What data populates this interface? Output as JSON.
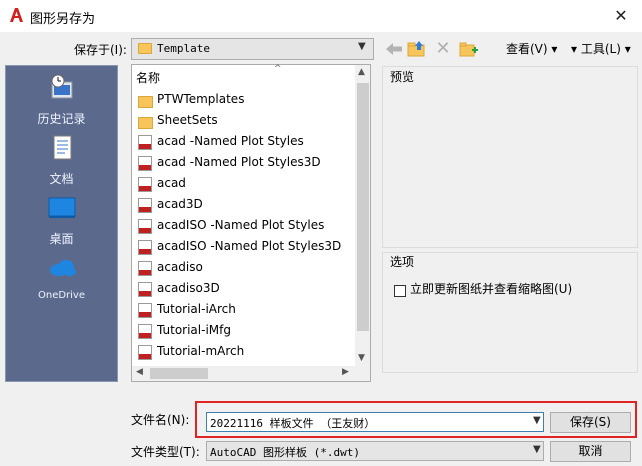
{
  "window": {
    "title": "图形另存为",
    "close_glyph": "✕",
    "icon": "autocad-a-icon"
  },
  "colors": {
    "accent": "#3c7fb1",
    "highlight": "#e02424",
    "places_bg": "#5b6a8c",
    "folder": "#f7c55a",
    "dwg_red": "#c02020"
  },
  "toolbar": {
    "save_in_label": "保存于(I):",
    "save_in_value": "Template",
    "view_menu": "查看(V)  ▾",
    "tools_menu": "▾  工具(L)  ▾",
    "icons": [
      "back-arrow-icon",
      "up-folder-icon",
      "delete-icon",
      "new-folder-icon"
    ]
  },
  "places": [
    {
      "label": "历史记录",
      "icon": "history-icon"
    },
    {
      "label": "文档",
      "icon": "documents-icon"
    },
    {
      "label": "桌面",
      "icon": "desktop-icon"
    },
    {
      "label": "OneDrive",
      "icon": "onedrive-icon"
    }
  ],
  "file_list": {
    "column_header": "名称",
    "items": [
      {
        "name": "PTWTemplates",
        "type": "folder"
      },
      {
        "name": "SheetSets",
        "type": "folder"
      },
      {
        "name": "acad -Named Plot Styles",
        "type": "dwt"
      },
      {
        "name": "acad -Named Plot Styles3D",
        "type": "dwt"
      },
      {
        "name": "acad",
        "type": "dwt"
      },
      {
        "name": "acad3D",
        "type": "dwt"
      },
      {
        "name": "acadISO -Named Plot Styles",
        "type": "dwt"
      },
      {
        "name": "acadISO -Named Plot Styles3D",
        "type": "dwt"
      },
      {
        "name": "acadiso",
        "type": "dwt"
      },
      {
        "name": "acadiso3D",
        "type": "dwt"
      },
      {
        "name": "Tutorial-iArch",
        "type": "dwt"
      },
      {
        "name": "Tutorial-iMfg",
        "type": "dwt"
      },
      {
        "name": "Tutorial-mArch",
        "type": "dwt"
      }
    ]
  },
  "preview": {
    "label": "预览"
  },
  "options": {
    "label": "选项",
    "checkbox_label": "立即更新图纸并查看缩略图(U)",
    "checked": false
  },
  "bottom": {
    "filename_label": "文件名(N):",
    "filename_value": "20221116 样板文件 （王友财）",
    "save_button": "保存(S)",
    "filetype_label": "文件类型(T):",
    "filetype_value": "AutoCAD 图形样板 (*.dwt)",
    "cancel_button": "取消"
  }
}
